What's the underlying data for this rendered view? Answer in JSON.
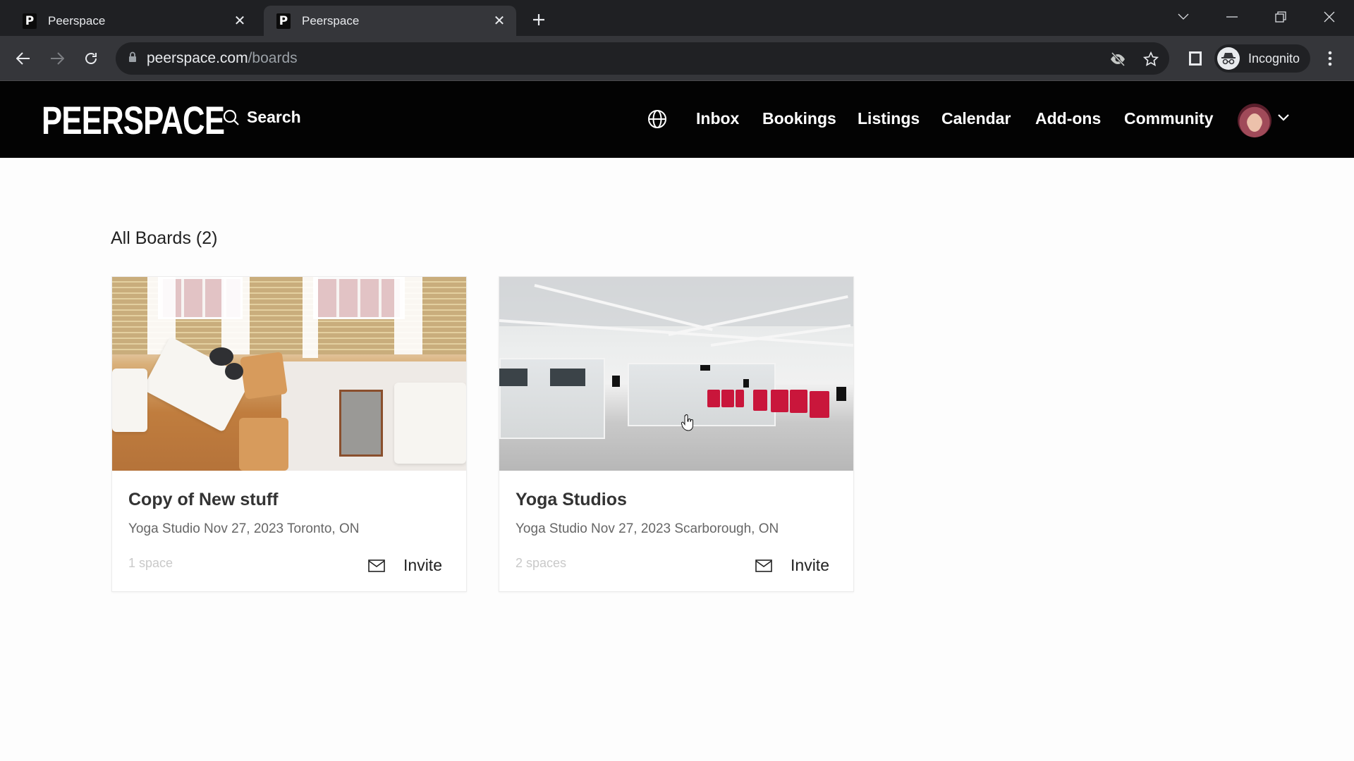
{
  "browser": {
    "tabs": [
      {
        "title": "Peerspace",
        "favicon": "P",
        "active": false
      },
      {
        "title": "Peerspace",
        "favicon": "P",
        "active": true
      }
    ],
    "new_tab_icon": "plus-icon",
    "address": {
      "host": "peerspace.com",
      "path": "/boards"
    },
    "profile_label": "Incognito",
    "window_controls": [
      "tab-search",
      "minimize",
      "restore",
      "close"
    ]
  },
  "header": {
    "logo": "PEERSPACE",
    "search_label": "Search",
    "nav": [
      {
        "label": "Inbox"
      },
      {
        "label": "Bookings"
      },
      {
        "label": "Listings"
      },
      {
        "label": "Calendar"
      },
      {
        "label": "Add-ons"
      },
      {
        "label": "Community"
      }
    ],
    "language_icon": "globe-icon",
    "avatar_icon": "user-avatar"
  },
  "main": {
    "title": "All Boards (2)",
    "boards": [
      {
        "name": "Copy of New stuff",
        "subtitle": "Yoga Studio Nov 27, 2023 Toronto, ON",
        "count": "1 space",
        "invite_label": "Invite",
        "image": "loft-living-room-photo"
      },
      {
        "name": "Yoga Studios",
        "subtitle": "Yoga Studio Nov 27, 2023 Scarborough, ON",
        "count": "2 spaces",
        "invite_label": "Invite",
        "image": "yoga-studio-photo"
      }
    ]
  },
  "colors": {
    "header_bg": "#030303",
    "chrome_bg": "#1f2023",
    "toolbar_bg": "#35363a",
    "page_bg": "#fdfdfd",
    "mat_red": "#c9163b"
  }
}
